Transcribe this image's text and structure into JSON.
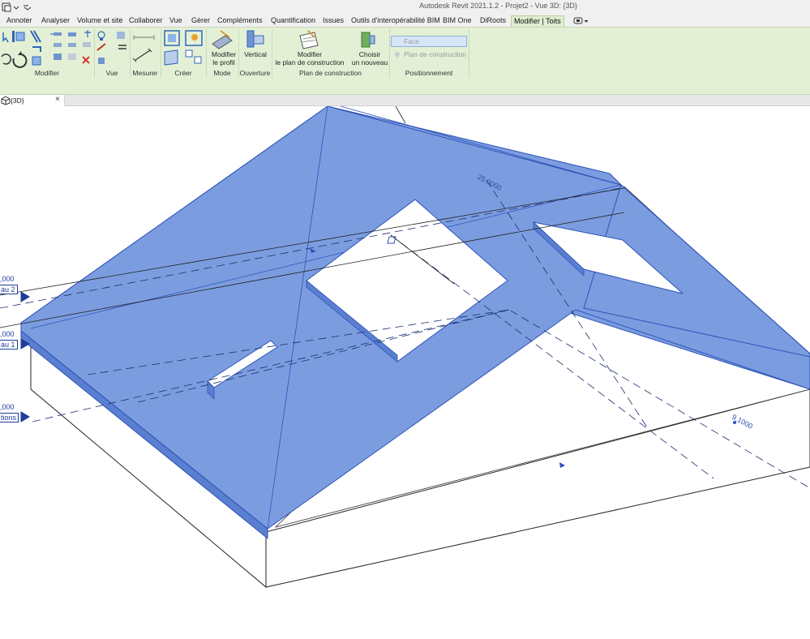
{
  "window": {
    "title": "Autodesk Revit 2021.1.2 - Projet2 - Vue 3D: {3D}"
  },
  "tabs": [
    {
      "label": "Annoter"
    },
    {
      "label": "Analyser"
    },
    {
      "label": "Volume et site"
    },
    {
      "label": "Collaborer"
    },
    {
      "label": "Vue"
    },
    {
      "label": "Gérer"
    },
    {
      "label": "Compléments"
    },
    {
      "label": "Quantification"
    },
    {
      "label": "Issues"
    },
    {
      "label": "Outils d'interopérabilité BIM"
    },
    {
      "label": "BIM One"
    },
    {
      "label": "DiRoots"
    },
    {
      "label": "Modifier | Toits"
    }
  ],
  "ribbon": {
    "panels": [
      {
        "label": "Modifier"
      },
      {
        "label": "Vue"
      },
      {
        "label": "Mesurer"
      },
      {
        "label": "Créer"
      },
      {
        "label": "Mode"
      },
      {
        "label": "Ouverture"
      },
      {
        "label": "Plan de construction"
      },
      {
        "label": "Positionnement"
      }
    ],
    "buttons": {
      "modifier_profil": {
        "line1": "Modifier",
        "line2": "le profil"
      },
      "vertical": {
        "line1": "Vertical"
      },
      "modifier_plan": {
        "line1": "Modifier",
        "line2": "le plan de construction"
      },
      "choisir": {
        "line1": "Choisir",
        "line2": "un nouveau"
      },
      "face": {
        "label": "Face"
      },
      "plan_construction": {
        "label": "Plan de construction"
      }
    }
  },
  "view": {
    "tab_label": "{3D}",
    "close_glyph": "×"
  },
  "canvas": {
    "dimension_ridge": "25.0000",
    "dimension_right": "9.1000",
    "levels": [
      {
        "elevation": ",000",
        "name": "au 2"
      },
      {
        "elevation": ",000",
        "name": "au 1"
      },
      {
        "elevation": ",000",
        "name": "tions"
      }
    ]
  },
  "colors": {
    "roof_fill": "#7b9de0",
    "roof_edge": "#2d52b8",
    "ribbon_bg": "#e4f0d6",
    "active_tab": "#dfedd0"
  }
}
